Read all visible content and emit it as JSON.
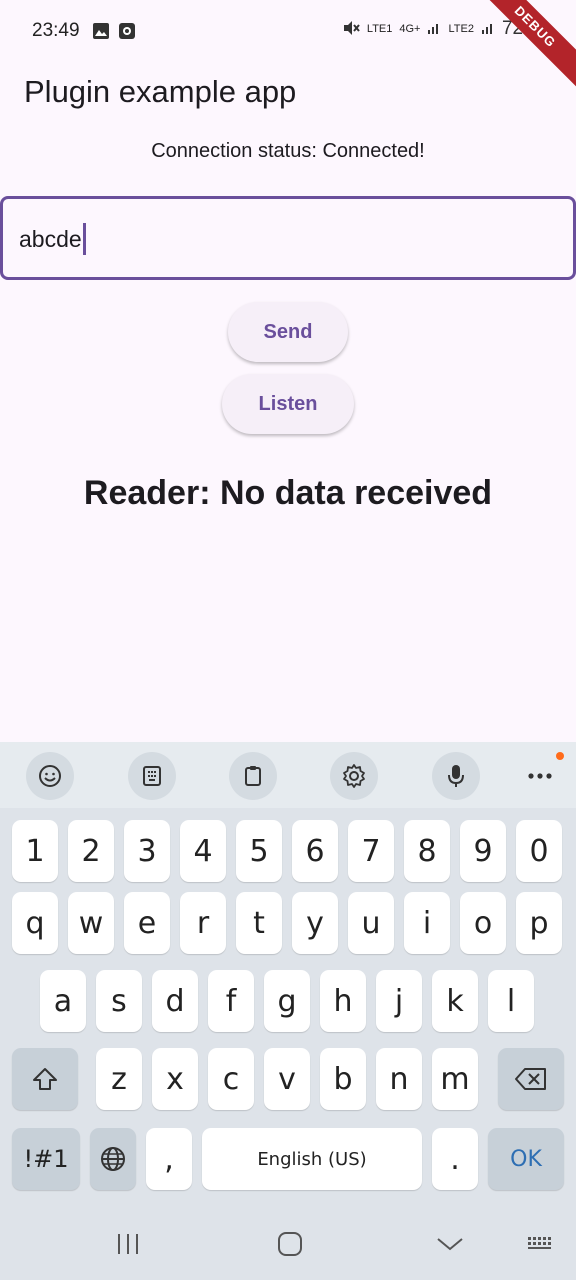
{
  "status_bar": {
    "time": "23:49",
    "left_icons": [
      "image-icon",
      "media-icon"
    ],
    "sim1": "LTE1",
    "sim2": "LTE2",
    "network": "4G+",
    "battery": "72%",
    "debug_label": "DEBUG"
  },
  "app": {
    "title": "Plugin example app",
    "connection_status": "Connection status: Connected!",
    "input_value": "abcde",
    "send_label": "Send",
    "listen_label": "Listen",
    "reader_text": "Reader: No data received",
    "accent_color": "#6a4f9c"
  },
  "keyboard": {
    "toolbar": [
      "emoji-icon",
      "keypad-icon",
      "clipboard-icon",
      "settings-icon",
      "microphone-icon",
      "more-icon"
    ],
    "row1": [
      "1",
      "2",
      "3",
      "4",
      "5",
      "6",
      "7",
      "8",
      "9",
      "0"
    ],
    "row2": [
      "q",
      "w",
      "e",
      "r",
      "t",
      "y",
      "u",
      "i",
      "o",
      "p"
    ],
    "row3": [
      "a",
      "s",
      "d",
      "f",
      "g",
      "h",
      "j",
      "k",
      "l"
    ],
    "row4": [
      "z",
      "x",
      "c",
      "v",
      "b",
      "n",
      "m"
    ],
    "symbols_label": "!#1",
    "comma": ",",
    "space_label": "English (US)",
    "period": ".",
    "ok_label": "OK"
  },
  "navbar": [
    "recent-apps-icon",
    "home-icon",
    "back-icon",
    "keyboard-switch-icon"
  ]
}
